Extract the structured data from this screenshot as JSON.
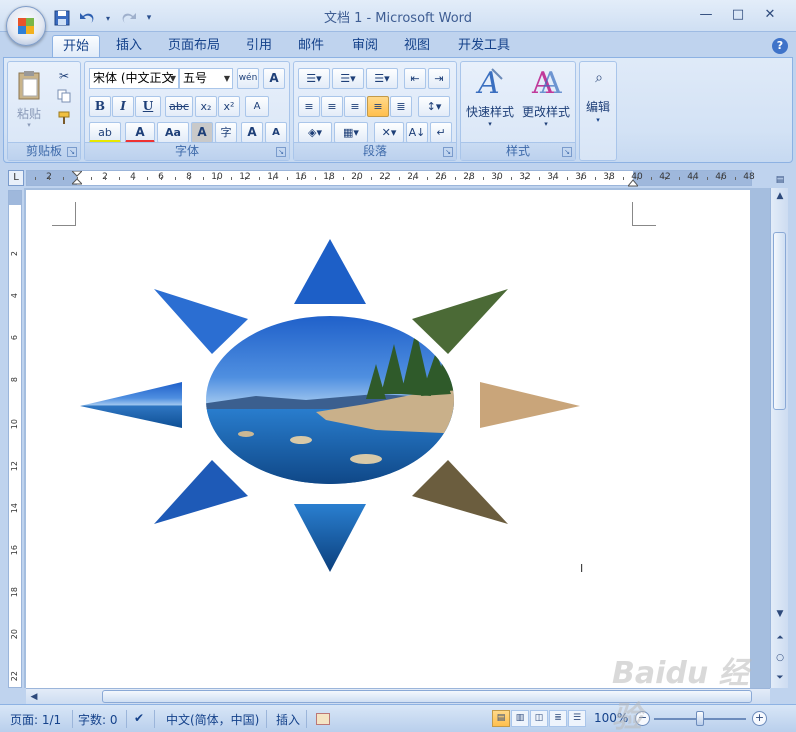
{
  "window": {
    "title": "文档 1 - Microsoft Word",
    "minimize": "—",
    "maximize": "□",
    "close": "✕"
  },
  "quick_access": {
    "save_icon": "save-icon",
    "undo_icon": "undo-icon",
    "redo_icon": "redo-icon",
    "customize_icon": "customize-icon"
  },
  "tabs": [
    {
      "label": "开始",
      "active": true
    },
    {
      "label": "插入"
    },
    {
      "label": "页面布局"
    },
    {
      "label": "引用"
    },
    {
      "label": "邮件"
    },
    {
      "label": "审阅"
    },
    {
      "label": "视图"
    },
    {
      "label": "开发工具"
    }
  ],
  "ribbon": {
    "clipboard": {
      "label": "剪贴板",
      "paste": "粘贴"
    },
    "font": {
      "label": "字体",
      "font_name": "宋体 (中文正文",
      "font_size": "五号",
      "bold": "B",
      "italic": "I",
      "underline": "U",
      "strike": "abc",
      "subscript": "x₂",
      "superscript": "x²",
      "highlight": "ab",
      "font_color": "A",
      "change_case": "Aa",
      "char_shading": "A",
      "enclose": "字",
      "grow": "A",
      "shrink": "A",
      "phonetic": "wén",
      "border_char": "A",
      "clear_format": "A"
    },
    "paragraph": {
      "label": "段落"
    },
    "styles": {
      "label": "样式",
      "quick_styles": "快速样式",
      "change_styles": "更改样式"
    },
    "editing": {
      "label": "编辑"
    }
  },
  "ruler": {
    "corner": "L",
    "h_numbers": [
      "2",
      "2",
      "4",
      "6",
      "8",
      "10",
      "12",
      "14",
      "16",
      "18",
      "20",
      "22",
      "24",
      "26",
      "28",
      "30",
      "32",
      "34",
      "36",
      "38",
      "40",
      "42",
      "44",
      "46",
      "48"
    ],
    "v_numbers": [
      "2",
      "4",
      "6",
      "8",
      "10",
      "12",
      "14",
      "16",
      "18",
      "20",
      "22"
    ]
  },
  "statusbar": {
    "page": "页面: 1/1",
    "words": "字数: 0",
    "language": "中文(简体，中国)",
    "mode": "插入",
    "zoom": "100%"
  },
  "watermark": "Baidu 经验"
}
